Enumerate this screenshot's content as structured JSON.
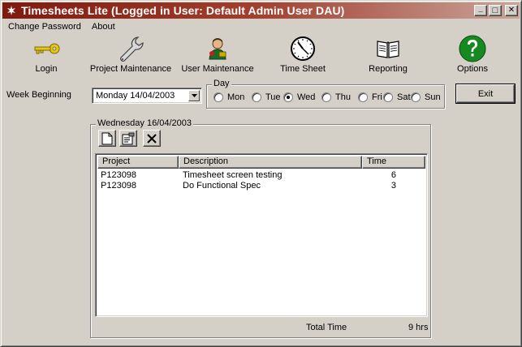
{
  "window": {
    "title": "Timesheets Lite (Logged in User: Default Admin User DAU)",
    "minimize_glyph": "_",
    "maximize_glyph": "□",
    "close_glyph": "✕"
  },
  "menu": {
    "items": [
      "Change Password",
      "About"
    ]
  },
  "toolbar": {
    "items": [
      {
        "label": "Login",
        "icon": "key-icon"
      },
      {
        "label": "Project Maintenance",
        "icon": "wrench-icon"
      },
      {
        "label": "User Maintenance",
        "icon": "user-icon"
      },
      {
        "label": "Time Sheet",
        "icon": "clock-icon"
      },
      {
        "label": "Reporting",
        "icon": "book-icon"
      },
      {
        "label": "Options",
        "icon": "help-icon"
      }
    ]
  },
  "week": {
    "label": "Week Beginning",
    "value": "Monday 14/04/2003"
  },
  "day": {
    "legend": "Day",
    "options": [
      "Mon",
      "Tue",
      "Wed",
      "Thu",
      "Fri",
      "Sat",
      "Sun"
    ],
    "selected": "Wed"
  },
  "exit_label": "Exit",
  "entries": {
    "legend": "Wednesday 16/04/2003",
    "columns": [
      "Project",
      "Description",
      "Time"
    ],
    "rows": [
      {
        "project": "P123098",
        "description": "Timesheet screen testing",
        "time": "6"
      },
      {
        "project": "P123098",
        "description": "Do Functional Spec",
        "time": "3"
      }
    ],
    "total_label": "Total Time",
    "total_value": "9 hrs"
  },
  "colors": {
    "titlebar_start": "#7f1a0e",
    "titlebar_end": "#c9a49a",
    "face": "#d4d0c8"
  }
}
